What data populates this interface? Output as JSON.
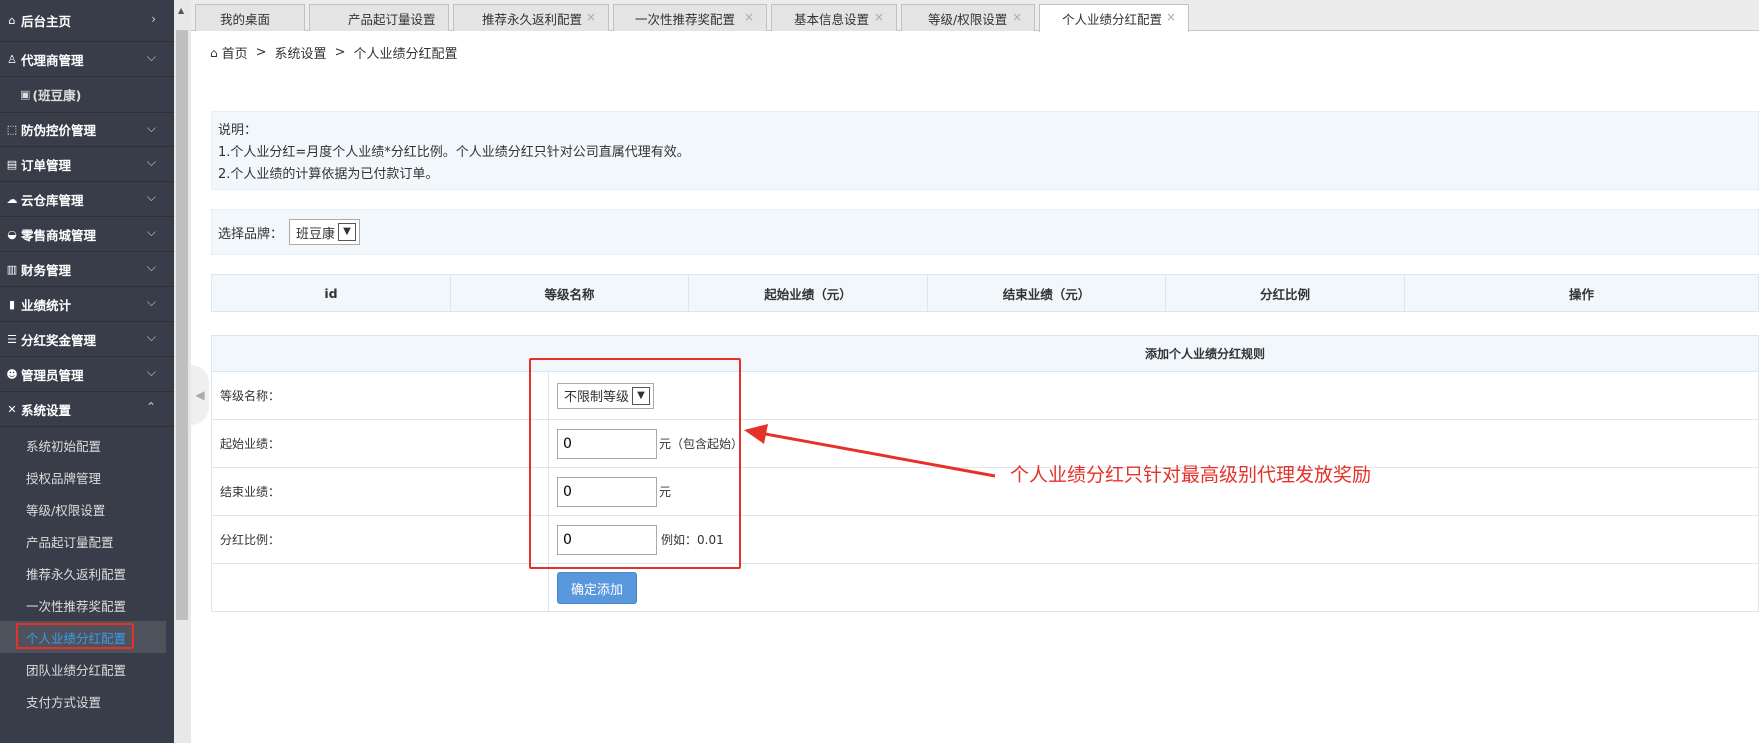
{
  "sidebar": {
    "items": [
      {
        "icon": "⌂",
        "icon_name": "home-icon",
        "label": "后台主页",
        "chevron": "›"
      },
      {
        "icon": "♙",
        "icon_name": "user-icon",
        "label": "代理商管理",
        "chevron": "⌵",
        "sub": [
          {
            "icon": "▣",
            "label": "(班豆康)"
          }
        ]
      },
      {
        "icon": "⬚",
        "icon_name": "scan-icon",
        "label": "防伪控价管理",
        "chevron": "⌵"
      },
      {
        "icon": "▤",
        "icon_name": "order-icon",
        "label": "订单管理",
        "chevron": "⌵"
      },
      {
        "icon": "☁",
        "icon_name": "cloud-icon",
        "label": "云仓库管理",
        "chevron": "⌵"
      },
      {
        "icon": "◒",
        "icon_name": "store-icon",
        "label": "零售商城管理",
        "chevron": "⌵"
      },
      {
        "icon": "▥",
        "icon_name": "finance-icon",
        "label": "财务管理",
        "chevron": "⌵"
      },
      {
        "icon": "▮",
        "icon_name": "chart-icon",
        "label": "业绩统计",
        "chevron": "⌵"
      },
      {
        "icon": "☰",
        "icon_name": "database-icon",
        "label": "分红奖金管理",
        "chevron": "⌵"
      },
      {
        "icon": "☻",
        "icon_name": "admin-icon",
        "label": "管理员管理",
        "chevron": "⌵"
      },
      {
        "icon": "✕",
        "icon_name": "tools-icon",
        "label": "系统设置",
        "chevron": "⌃"
      }
    ],
    "system_sub": [
      "系统初始配置",
      "授权品牌管理",
      "等级/权限设置",
      "产品起订量配置",
      "推荐永久返利配置",
      "一次性推荐奖配置",
      "个人业绩分红配置",
      "团队业绩分红配置",
      "支付方式设置"
    ]
  },
  "tabs": [
    {
      "label": "我的桌面",
      "close": false
    },
    {
      "label": "产品起订量设置",
      "close": true
    },
    {
      "label": "推荐永久返利配置",
      "close": true
    },
    {
      "label": "一次性推荐奖配置",
      "close": true
    },
    {
      "label": "基本信息设置",
      "close": true
    },
    {
      "label": "等级/权限设置",
      "close": true
    },
    {
      "label": "个人业绩分红配置",
      "close": true
    }
  ],
  "close_glyph": "×",
  "breadcrumb": {
    "home": "首页",
    "sep": ">",
    "section": "系统设置",
    "page": "个人业绩分红配置"
  },
  "notice": {
    "title": "说明：",
    "line1": "1.个人业分红=月度个人业绩*分红比例。个人业绩分红只针对公司直属代理有效。",
    "line2": "2.个人业绩的计算依据为已付款订单。"
  },
  "brand": {
    "label": "选择品牌：",
    "value": "班豆康"
  },
  "table": {
    "headers": [
      "id",
      "等级名称",
      "起始业绩（元）",
      "结束业绩（元）",
      "分红比例",
      "操作"
    ]
  },
  "form": {
    "title": "添加个人业绩分红规则",
    "level_label": "等级名称：",
    "level_value": "不限制等级",
    "start_label": "起始业绩：",
    "start_value": "0",
    "start_unit": "元（包含起始）",
    "end_label": "结束业绩：",
    "end_value": "0",
    "end_unit": "元",
    "ratio_label": "分红比例：",
    "ratio_value": "0",
    "ratio_hint": "例如：0.01",
    "submit_label": "确定添加"
  },
  "annotation": {
    "text": "个人业绩分红只针对最高级别代理发放奖励",
    "color": "#e4322b"
  },
  "colors": {
    "sidebar_bg": "#393d49",
    "accent": "#5a98de",
    "active_text": "#3a9be8",
    "highlight": "#e4322b"
  }
}
